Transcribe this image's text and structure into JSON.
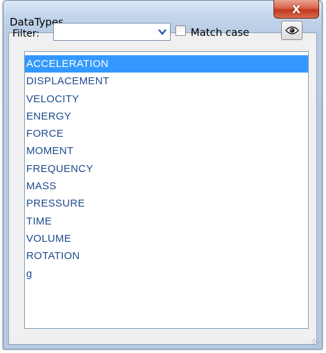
{
  "window": {
    "title": "DataTypes",
    "close_glyph": "X"
  },
  "filter": {
    "label": "Filter:",
    "value": "",
    "placeholder": ""
  },
  "match_case": {
    "label": "Match case",
    "checked": false
  },
  "eye_button": {
    "icon": "eye-icon"
  },
  "list": {
    "selected_index": 0,
    "items": [
      "ACCELERATION",
      "DISPLACEMENT",
      "VELOCITY",
      "ENERGY",
      "FORCE",
      "MOMENT",
      "FREQUENCY",
      "MASS",
      "PRESSURE",
      "TIME",
      "VOLUME",
      "ROTATION",
      "g"
    ]
  },
  "colors": {
    "selection": "#3399ff",
    "item_text": "#1e4a8c",
    "close_button": "#c2381d"
  }
}
